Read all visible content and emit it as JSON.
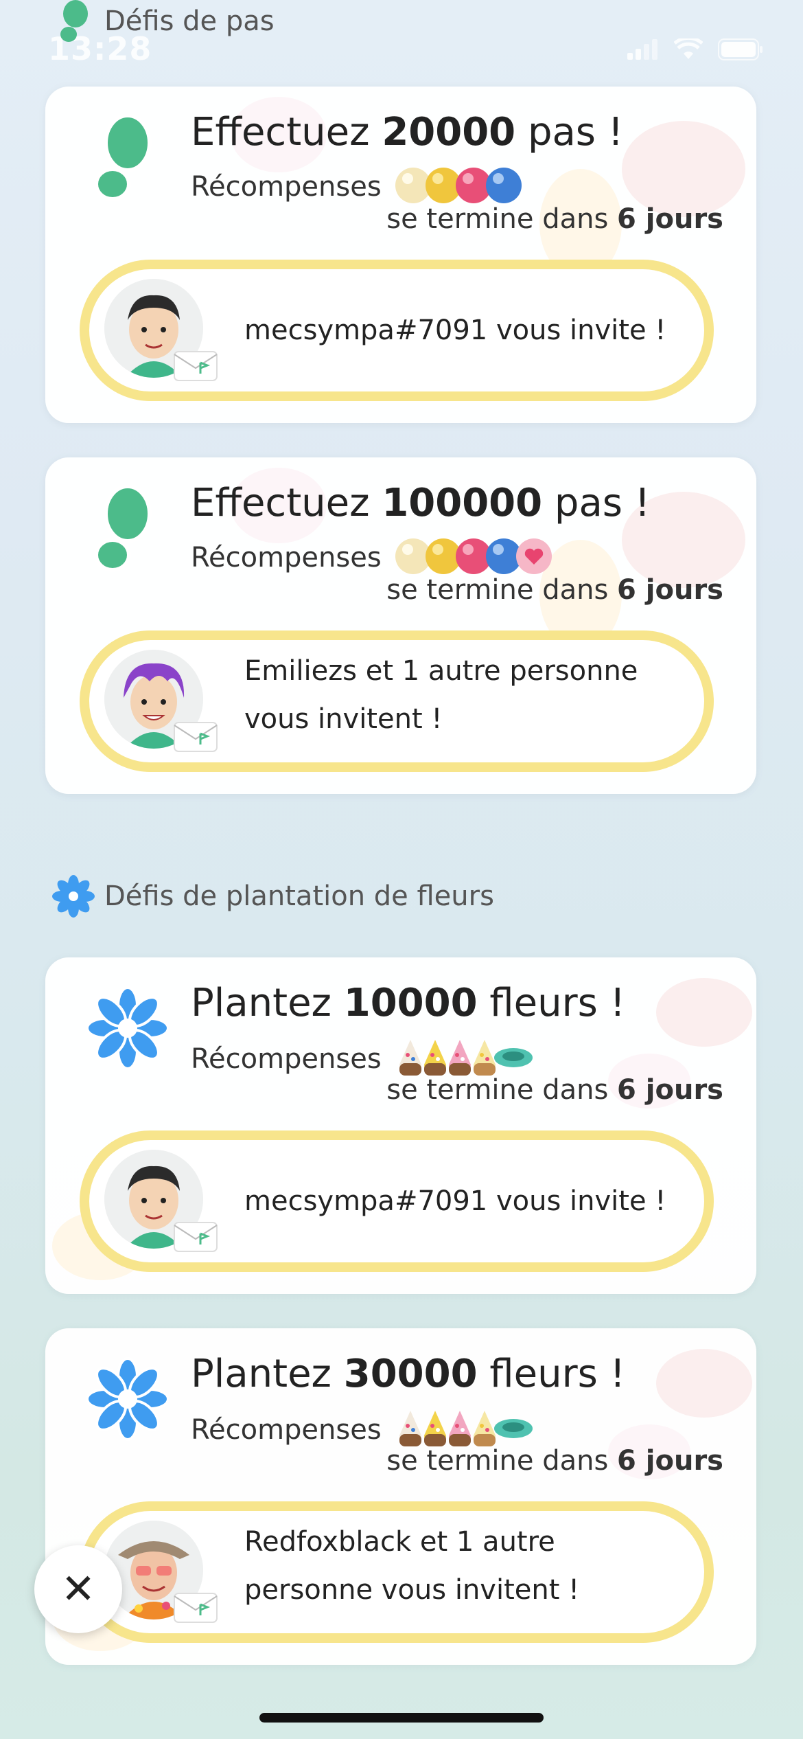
{
  "status_bar": {
    "time": "13:28"
  },
  "sections": [
    {
      "header": "Défis de pas",
      "icon": "footprint-icon",
      "cards": [
        {
          "title_pre": "Effectuez ",
          "title_num": "20000",
          "title_post": " pas !",
          "rewards_label": "Récompenses",
          "ends_pre": "se termine dans ",
          "ends_bold": "6 jours",
          "invite_text": "mecsympa#7091 vous invite !",
          "reward_icons": [
            "pearl-icon",
            "gold-bead-icon",
            "pink-bead-icon",
            "blue-bead-icon"
          ]
        },
        {
          "title_pre": "Effectuez ",
          "title_num": "100000",
          "title_post": " pas !",
          "rewards_label": "Récompenses",
          "ends_pre": "se termine dans ",
          "ends_bold": "6 jours",
          "invite_text": "Emiliezs et 1 autre personne vous invitent !",
          "reward_icons": [
            "pearl-icon",
            "gold-bead-icon",
            "pink-bead-icon",
            "blue-bead-icon",
            "heart-bead-icon"
          ]
        }
      ]
    },
    {
      "header": "Défis de plantation de fleurs",
      "icon": "flower-icon",
      "cards": [
        {
          "title_pre": "Plantez ",
          "title_num": "10000",
          "title_post": " fleurs !",
          "rewards_label": "Récompenses",
          "ends_pre": "se termine dans ",
          "ends_bold": "6 jours",
          "invite_text": "mecsympa#7091 vous invite !",
          "reward_icons": [
            "seed-bag-icon",
            "seed-bag-icon",
            "seed-bag-icon",
            "seed-bag-icon",
            "planter-icon"
          ]
        },
        {
          "title_pre": "Plantez ",
          "title_num": "30000",
          "title_post": " fleurs !",
          "rewards_label": "Récompenses",
          "ends_pre": "se termine dans ",
          "ends_bold": "6 jours",
          "invite_text": "Redfoxblack et 1 autre personne vous invitent !",
          "reward_icons": [
            "seed-bag-icon",
            "seed-bag-icon",
            "seed-bag-icon",
            "seed-bag-icon",
            "planter-icon"
          ]
        }
      ]
    }
  ],
  "close_label": "✕",
  "colors": {
    "footprint": "#4cbb8a",
    "flower": "#3f9cf0",
    "invite_border": "#f7e58c"
  }
}
